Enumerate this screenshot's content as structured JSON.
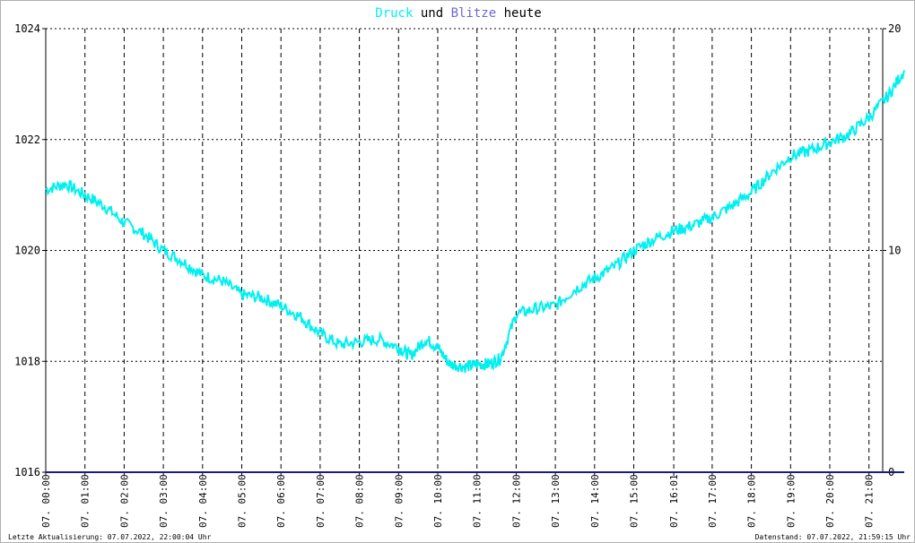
{
  "title": {
    "part1": "Druck",
    "part2": " und ",
    "part3": "Blitze",
    "part4": " heute",
    "color_druck": "#00f0f0",
    "color_blitze": "#6a6ad0",
    "color_text": "#000000"
  },
  "footer": {
    "left": "Letzte Aktualisierung: 07.07.2022, 22:00:04 Uhr",
    "right": "Datenstand: 07.07.2022, 21:59:15 Uhr"
  },
  "chart_data": {
    "type": "line",
    "title": "Druck und Blitze heute",
    "xlabel": "",
    "ylabel": "",
    "ylim": [
      1016,
      1024
    ],
    "y2lim": [
      0,
      20
    ],
    "y_ticks": [
      1016,
      1018,
      1020,
      1022,
      1024
    ],
    "y2_ticks": [
      0,
      10,
      20
    ],
    "grid": true,
    "x_range_hours": [
      0,
      22
    ],
    "x_ticks": [
      {
        "h": 0,
        "label": "07. 00:00"
      },
      {
        "h": 1,
        "label": "07. 01:00"
      },
      {
        "h": 2,
        "label": "07. 02:00"
      },
      {
        "h": 3,
        "label": "07. 03:00"
      },
      {
        "h": 4,
        "label": "07. 04:00"
      },
      {
        "h": 5,
        "label": "07. 05:00"
      },
      {
        "h": 6,
        "label": "07. 06:00"
      },
      {
        "h": 7,
        "label": "07. 07:00"
      },
      {
        "h": 8,
        "label": "07. 08:00"
      },
      {
        "h": 9,
        "label": "07. 09:00"
      },
      {
        "h": 10,
        "label": "07. 10:00"
      },
      {
        "h": 11,
        "label": "07. 11:00"
      },
      {
        "h": 12,
        "label": "07. 12:00"
      },
      {
        "h": 13,
        "label": "07. 13:00"
      },
      {
        "h": 14,
        "label": "07. 14:00"
      },
      {
        "h": 15,
        "label": "07. 15:00"
      },
      {
        "h": 16.02,
        "label": "07. 16:01"
      },
      {
        "h": 17,
        "label": "07. 17:00"
      },
      {
        "h": 18,
        "label": "07. 18:00"
      },
      {
        "h": 19,
        "label": "07. 19:00"
      },
      {
        "h": 20,
        "label": "07. 20:00"
      },
      {
        "h": 21,
        "label": "07. 21:00"
      }
    ],
    "series": [
      {
        "name": "Druck",
        "axis": "left",
        "color": "#00f0f0",
        "x": [
          0,
          0.5,
          1,
          1.5,
          2,
          2.5,
          3,
          3.5,
          4,
          4.5,
          5,
          5.5,
          6,
          6.5,
          7,
          7.5,
          8,
          8.5,
          9,
          9.3,
          9.7,
          10,
          10.3,
          10.7,
          11,
          11.3,
          11.6,
          12,
          12.5,
          13,
          13.5,
          14,
          14.5,
          15,
          15.5,
          16,
          16.5,
          17,
          17.5,
          18,
          18.5,
          19,
          19.5,
          20,
          20.5,
          21,
          21.5,
          21.9
        ],
        "values": [
          1021.1,
          1021.2,
          1021.0,
          1020.8,
          1020.5,
          1020.3,
          1020.0,
          1019.8,
          1019.55,
          1019.45,
          1019.2,
          1019.15,
          1019.0,
          1018.8,
          1018.5,
          1018.3,
          1018.35,
          1018.4,
          1018.25,
          1018.1,
          1018.4,
          1018.25,
          1017.95,
          1017.9,
          1017.95,
          1017.95,
          1018.05,
          1018.85,
          1018.95,
          1019.0,
          1019.3,
          1019.5,
          1019.7,
          1020.0,
          1020.2,
          1020.35,
          1020.45,
          1020.6,
          1020.8,
          1021.05,
          1021.4,
          1021.7,
          1021.8,
          1021.95,
          1022.1,
          1022.4,
          1022.8,
          1023.25
        ]
      },
      {
        "name": "Blitze",
        "axis": "right",
        "color": "#1a1a80",
        "x": [
          0,
          21.9
        ],
        "values": [
          0,
          0
        ]
      }
    ]
  }
}
